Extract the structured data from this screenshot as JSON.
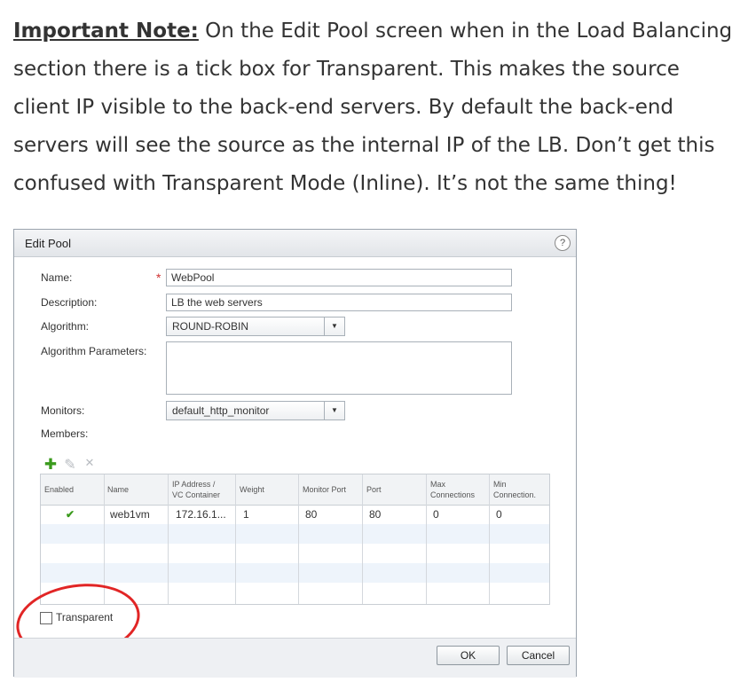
{
  "note": {
    "strong": "Important Note:",
    "text": " On the Edit Pool screen when in the Load Balancing section there is a tick box for Transparent. This makes the source client IP visible to the back-end servers. By default the back-end servers will see the source as the internal IP of the LB. Don’t get this confused with Transparent Mode (Inline). It’s not the same thing!"
  },
  "dialog": {
    "title": "Edit Pool",
    "help": "?",
    "labels": {
      "name": "Name:",
      "description": "Description:",
      "algorithm": "Algorithm:",
      "algorithm_parameters": "Algorithm Parameters:",
      "monitors": "Monitors:",
      "members": "Members:"
    },
    "required_mark": "*",
    "fields": {
      "name": "WebPool",
      "description": "LB the web servers",
      "algorithm": "ROUND-ROBIN",
      "algorithm_parameters": "",
      "monitors": "default_http_monitor"
    },
    "toolbar": {
      "add": "✚",
      "edit": "✎",
      "delete": "✕"
    },
    "table": {
      "headers": {
        "enabled": "Enabled",
        "name": "Name",
        "ip_line1": "IP Address /",
        "ip_line2": "VC Container",
        "weight": "Weight",
        "monitor_port": "Monitor Port",
        "port": "Port",
        "max_line1": "Max",
        "max_line2": "Connections",
        "min_line1": "Min",
        "min_line2": "Connection."
      },
      "row": {
        "enabled": "✔",
        "name": "web1vm",
        "ip": "172.16.1...",
        "weight": "1",
        "monitor_port": "80",
        "port": "80",
        "max": "0",
        "min": "0"
      }
    },
    "transparent_label": "Transparent",
    "ok": "OK",
    "cancel": "Cancel"
  },
  "colors": {
    "annotation": "#e12525",
    "check": "#3a9a1c",
    "add": "#3a9a1c"
  }
}
